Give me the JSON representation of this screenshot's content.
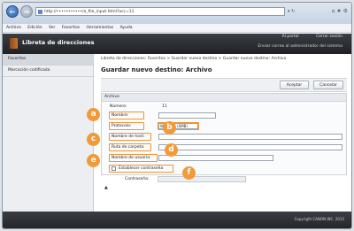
{
  "browser": {
    "address": "http://•••••••••••/a_file_input.html?acc=11",
    "menu": [
      "Archivo",
      "Edición",
      "Ver",
      "Favoritos",
      "Herramientas",
      "Ayuda"
    ]
  },
  "app": {
    "title": "Libreta de direcciones",
    "portal": "Al portal",
    "logout": "Cerrar sesión",
    "admin_link": "Enviar correo al administrador del sistema"
  },
  "sidebar": {
    "items": [
      {
        "label": "Favoritos"
      },
      {
        "label": "Marcación codificada"
      }
    ]
  },
  "main": {
    "breadcrumb": "Libreta de direcciones: Favoritos > Guardar nuevo destino > Guardar nuevo destino: Archivo",
    "title": "Guardar nuevo destino: Archivo",
    "accept": "Aceptar",
    "cancel": "Cancelar",
    "section": "Archivo",
    "fields": {
      "number_label": "Número:",
      "number_value": "11",
      "name_label": "Nombre:",
      "protocol_label": "Protocolo:",
      "protocol_value": "Windows (SMB)",
      "host_label": "Nombre de host:",
      "folder_label": "Ruta de carpeta:",
      "user_label": "Nombre de usuario:",
      "set_password_label": "Establecer contraseña",
      "password_label": "Contraseña:"
    },
    "top_mark": "▲"
  },
  "callouts": [
    "a",
    "b",
    "c",
    "d",
    "e",
    "f"
  ],
  "footer": {
    "copyright": "Copyright CANON INC. 2015"
  },
  "colors": {
    "callout": "#f29a38",
    "header": "#2b2d31"
  }
}
